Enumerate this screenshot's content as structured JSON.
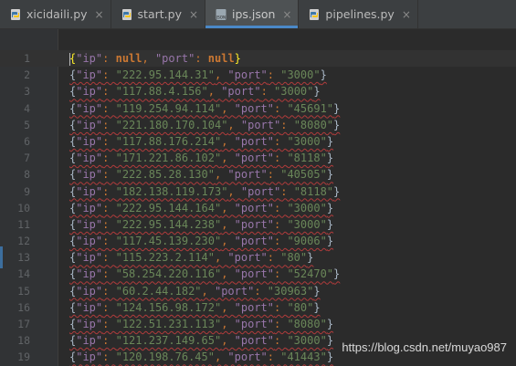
{
  "tabs": [
    {
      "label": "xicidaili.py",
      "icon": "python-file-icon",
      "active": false
    },
    {
      "label": "start.py",
      "icon": "python-file-icon",
      "active": false
    },
    {
      "label": "ips.json",
      "icon": "json-file-icon",
      "active": true
    },
    {
      "label": "pipelines.py",
      "icon": "python-file-icon",
      "active": false
    }
  ],
  "tab_close_glyph": "×",
  "json_icon_text": "JSON",
  "first_line": {
    "num": "1",
    "key1": "\"ip\"",
    "val1": "null",
    "key2": "\"port\"",
    "val2": "null"
  },
  "rows": [
    {
      "num": "2",
      "ip": "\"222.95.144.31\"",
      "port": "\"3000\""
    },
    {
      "num": "3",
      "ip": "\"117.88.4.156\"",
      "port": "\"3000\""
    },
    {
      "num": "4",
      "ip": "\"119.254.94.114\"",
      "port": "\"45691\""
    },
    {
      "num": "5",
      "ip": "\"221.180.170.104\"",
      "port": "\"8080\""
    },
    {
      "num": "6",
      "ip": "\"117.88.176.214\"",
      "port": "\"3000\""
    },
    {
      "num": "7",
      "ip": "\"171.221.86.102\"",
      "port": "\"8118\""
    },
    {
      "num": "8",
      "ip": "\"222.85.28.130\"",
      "port": "\"40505\""
    },
    {
      "num": "9",
      "ip": "\"182.138.119.173\"",
      "port": "\"8118\""
    },
    {
      "num": "10",
      "ip": "\"222.95.144.164\"",
      "port": "\"3000\""
    },
    {
      "num": "11",
      "ip": "\"222.95.144.238\"",
      "port": "\"3000\""
    },
    {
      "num": "12",
      "ip": "\"117.45.139.230\"",
      "port": "\"9006\""
    },
    {
      "num": "13",
      "ip": "\"115.223.2.114\"",
      "port": "\"80\""
    },
    {
      "num": "14",
      "ip": "\"58.254.220.116\"",
      "port": "\"52470\""
    },
    {
      "num": "15",
      "ip": "\"60.2.44.182\"",
      "port": "\"30963\""
    },
    {
      "num": "16",
      "ip": "\"124.156.98.172\"",
      "port": "\"80\""
    },
    {
      "num": "17",
      "ip": "\"122.51.231.113\"",
      "port": "\"8080\""
    },
    {
      "num": "18",
      "ip": "\"121.237.149.65\"",
      "port": "\"3000\""
    },
    {
      "num": "19",
      "ip": "\"120.198.76.45\"",
      "port": "\"41443\""
    }
  ],
  "syntax": {
    "open": "{",
    "close": "}",
    "key_ip": "\"ip\"",
    "key_port": "\"port\"",
    "colon": ": ",
    "comma": ", "
  },
  "watermark": "https://blog.csdn.net/muyao987",
  "colors": {
    "background": "#2b2b2b",
    "gutter": "#313335",
    "tab_bar": "#3c3f41",
    "active_tab_underline": "#4a88c7",
    "key": "#9876aa",
    "string": "#6a8759",
    "keyword": "#cc7832",
    "line_number": "#606366",
    "error_squiggle": "#b03b3b"
  }
}
